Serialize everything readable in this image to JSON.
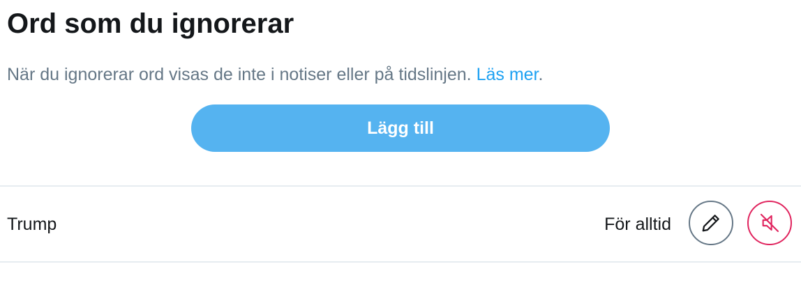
{
  "header": {
    "title": "Ord som du ignorerar"
  },
  "description": {
    "text": "När du ignorerar ord visas de inte i notiser eller på tidslinjen. ",
    "link_label": "Läs mer",
    "trailing": "."
  },
  "add_button": {
    "label": "Lägg till"
  },
  "muted_words": [
    {
      "word": "Trump",
      "duration": "För alltid",
      "edit_icon": "pencil-icon",
      "unmute_icon": "speaker-muted-icon"
    }
  ],
  "colors": {
    "accent": "#1da1f2",
    "button_bg": "#55b3f0",
    "danger": "#e0245e",
    "muted_text": "#657786",
    "divider": "#e6ecf0"
  }
}
